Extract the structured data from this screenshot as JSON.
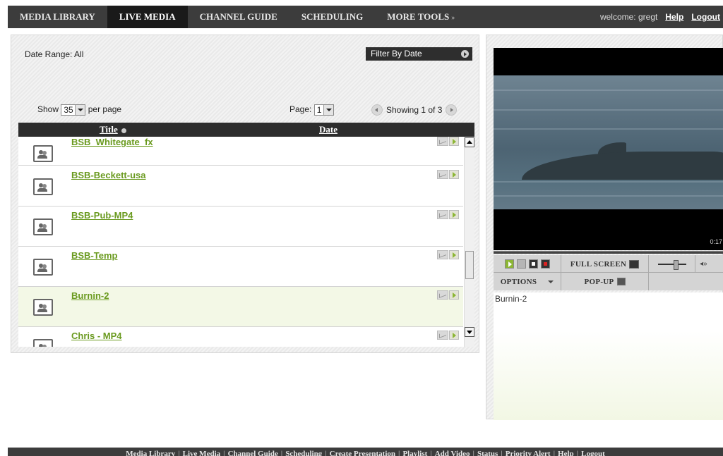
{
  "nav": {
    "tabs": [
      {
        "label": "MEDIA LIBRARY"
      },
      {
        "label": "LIVE MEDIA"
      },
      {
        "label": "CHANNEL GUIDE"
      },
      {
        "label": "SCHEDULING"
      },
      {
        "label": "MORE TOOLS"
      }
    ],
    "welcome": "welcome: gregt",
    "help": "Help",
    "logout": "Logout"
  },
  "filters": {
    "date_range": "Date Range: All",
    "filter_button": "Filter By Date"
  },
  "pager": {
    "show_label": "Show",
    "per_page_value": "35",
    "per_page_label": "per page",
    "page_label": "Page:",
    "page_value": "1",
    "showing": "Showing 1 of 3"
  },
  "list": {
    "columns": {
      "title": "Title",
      "date": "Date"
    },
    "rows": [
      {
        "name": "BSB_Whitegate_fx"
      },
      {
        "name": "BSB-Beckett-usa"
      },
      {
        "name": "BSB-Pub-MP4"
      },
      {
        "name": "BSB-Temp"
      },
      {
        "name": "Burnin-2"
      },
      {
        "name": "Chris - MP4"
      }
    ]
  },
  "player": {
    "time": "0:17",
    "fullscreen": "FULL SCREEN",
    "options": "OPTIONS",
    "popup": "POP-UP",
    "now_playing": "Burnin-2"
  },
  "footer": {
    "links": [
      "Media Library",
      "Live Media",
      "Channel Guide",
      "Scheduling",
      "Create Presentation",
      "Playlist",
      "Add Video",
      "Status",
      "Priority Alert",
      "Help",
      "Logout"
    ]
  }
}
